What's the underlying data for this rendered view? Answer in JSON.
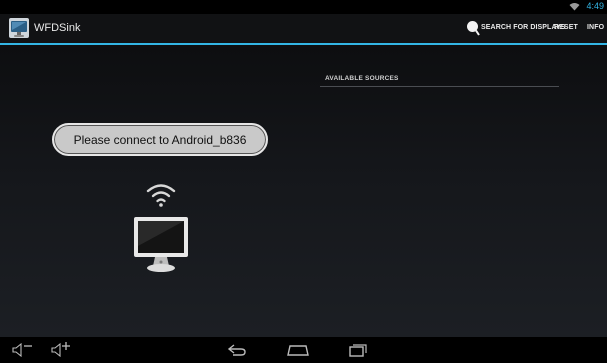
{
  "status_bar": {
    "time": "4:49",
    "wifi_icon": "wifi-icon"
  },
  "action_bar": {
    "app_title": "WFDSink",
    "app_icon": "monitor-app-icon",
    "search_label": "SEARCH FOR DISPLAYS",
    "reset_label": "RESET",
    "info_label": "INFO",
    "accent_color": "#33b5e5"
  },
  "main": {
    "sources_header": "AVAILABLE SOURCES",
    "toast_message": "Please connect to Android_b836",
    "illustration_icons": [
      "wifi-signal-icon",
      "monitor-icon"
    ]
  },
  "nav_bar": {
    "icons": [
      "volume-down-icon",
      "volume-up-icon",
      "back-icon",
      "home-icon",
      "recent-apps-icon"
    ]
  }
}
